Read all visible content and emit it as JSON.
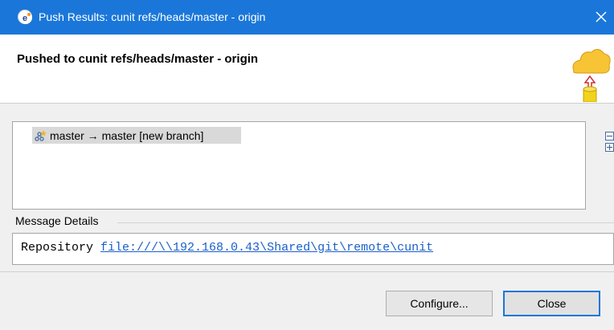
{
  "window": {
    "title": "Push Results: cunit refs/heads/master - origin",
    "app_icon": "eclipse-icon",
    "close_icon": "close-icon"
  },
  "header": {
    "title": "Pushed to cunit refs/heads/master - origin",
    "icon": "push-to-remote-icon"
  },
  "results": {
    "items": [
      {
        "label": "master → master [new branch]",
        "icon": "branch-icon"
      }
    ],
    "collapse_icon": "collapse-all-icon",
    "expand_icon": "expand-all-icon"
  },
  "message": {
    "label": "Message Details",
    "prefix": "Repository ",
    "link": "file:///\\\\192.168.0.43\\Shared\\git\\remote\\cunit"
  },
  "buttons": {
    "configure": "Configure...",
    "close": "Close"
  },
  "colors": {
    "titlebar": "#1a77d9",
    "link": "#1a5fc9",
    "selection": "#d9d9d9"
  }
}
